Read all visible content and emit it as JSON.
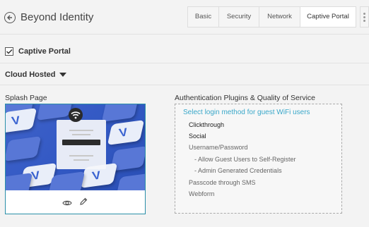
{
  "header": {
    "title": "Beyond Identity",
    "tabs": [
      {
        "label": "Basic",
        "active": false
      },
      {
        "label": "Security",
        "active": false
      },
      {
        "label": "Network",
        "active": false
      },
      {
        "label": "Captive Portal",
        "active": true
      }
    ]
  },
  "captive_portal": {
    "label": "Captive Portal",
    "checked": true
  },
  "hosting": {
    "selected": "Cloud Hosted"
  },
  "splash": {
    "title": "Splash Page"
  },
  "auth": {
    "title": "Authentication Plugins & Quality of Service",
    "prompt": "Select login method for guest WiFi users",
    "options": [
      {
        "label": "Clickthrough",
        "state": "enabled"
      },
      {
        "label": "Social",
        "state": "enabled"
      },
      {
        "label": "Username/Password",
        "state": "disabled"
      },
      {
        "label": "- Allow Guest Users to Self-Register",
        "state": "disabled"
      },
      {
        "label": "- Admin Generated Credentials",
        "state": "disabled"
      },
      {
        "label": "Passcode through SMS",
        "state": "disabled"
      },
      {
        "label": "Webform",
        "state": "disabled"
      }
    ]
  },
  "colors": {
    "accent": "#39a7c9",
    "card_border": "#2a8fa8",
    "splash_bg": "#3359c4"
  }
}
